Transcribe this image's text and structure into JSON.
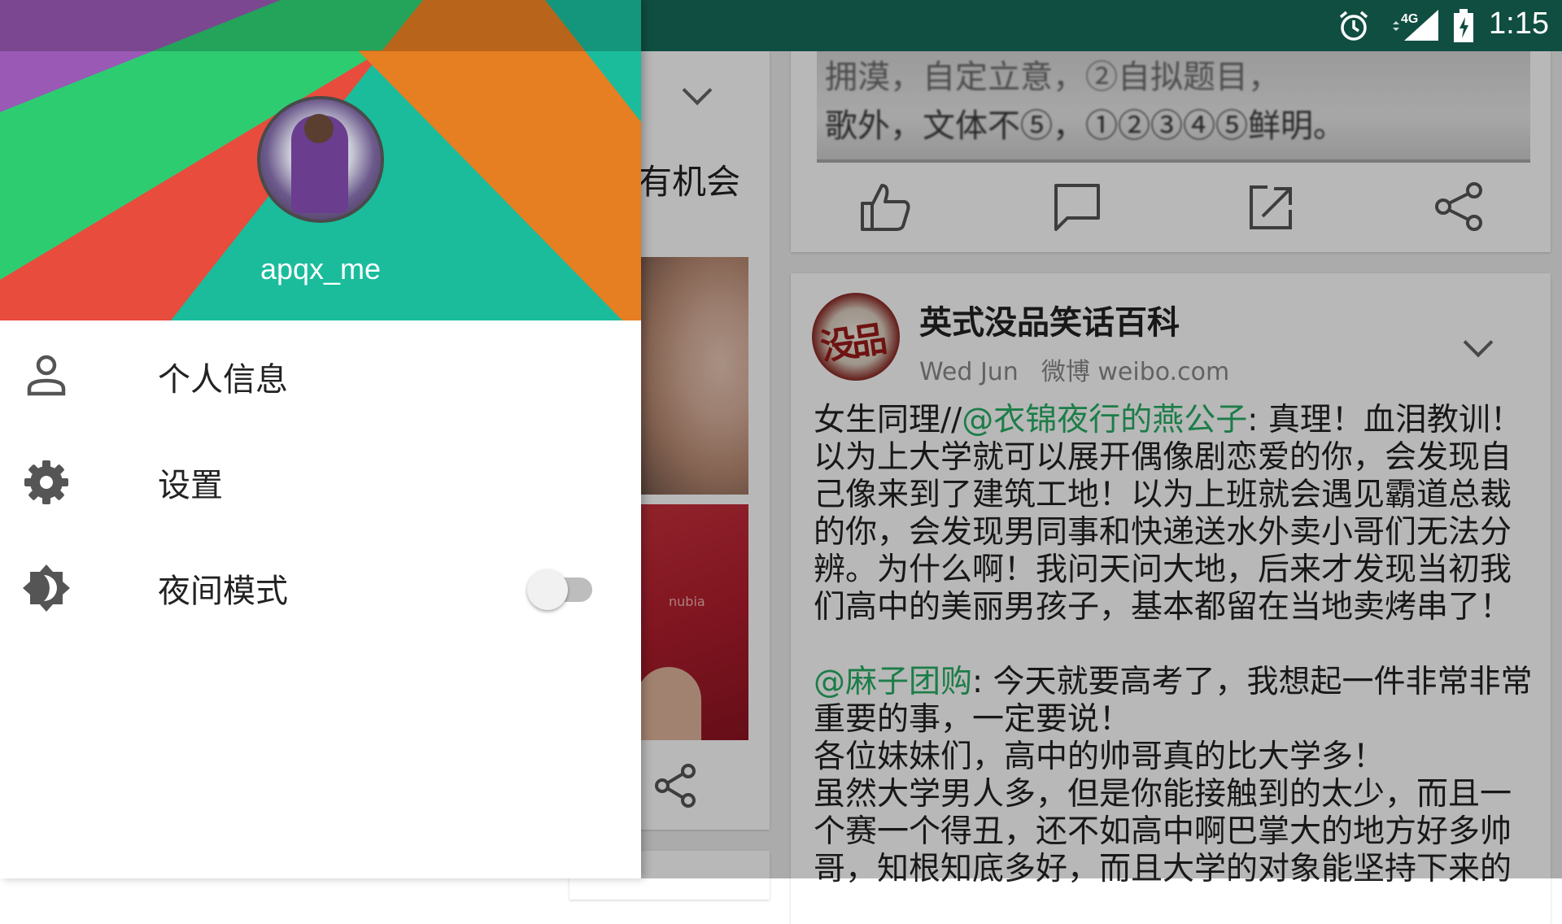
{
  "status_bar": {
    "time": "1:15",
    "network": "4G",
    "icons": [
      "gallery-icon",
      "n-icon",
      "alarm-icon",
      "signal-icon",
      "battery-icon"
    ]
  },
  "drawer": {
    "username": "apqx_me",
    "header_colors": [
      "#9b59b6",
      "#2ecc71",
      "#e74c3c",
      "#1abc9c",
      "#e67e22"
    ],
    "menu": [
      {
        "label": "个人信息",
        "icon": "person-icon"
      },
      {
        "label": "设置",
        "icon": "gear-icon"
      },
      {
        "label": "夜间模式",
        "icon": "brightness-icon",
        "toggle": false
      }
    ]
  },
  "feed": {
    "left_partial_text": "有机会",
    "phone_label": "nubia",
    "scan_text": {
      "line1": "拥漠，自定立意，②自拟题目，",
      "line2": "歌外，文体不⑤，①②③④⑤鲜明。"
    },
    "post": {
      "author": "英式没品笑话百科",
      "date": "Wed Jun",
      "source": "微博 weibo.com",
      "avatar_text": "没品",
      "para1_prefix": "女生同理//",
      "para1_mention": "@衣锦夜行的燕公子",
      "para1_text": ": 真理！血泪教训！以为上大学就可以展开偶像剧恋爱的你，会发现自己像来到了建筑工地！以为上班就会遇见霸道总裁的你，会发现男同事和快递送水外卖小哥们无法分辨。为什么啊！我问天问大地，后来才发现当初我们高中的美丽男孩子，基本都留在当地卖烤串了！",
      "para2_mention": "@麻子团购",
      "para2_text": ": 今天就要高考了，我想起一件非常非常重要的事，一定要说！",
      "line3": "各位妹妹们，高中的帅哥真的比大学多！",
      "line4": "虽然大学男人多，但是你能接触到的太少，而且一个赛一个得丑，还不如高中啊巴掌大的地方好多帅哥，知根知底多好，而且大学的对象能坚持下来的"
    }
  }
}
